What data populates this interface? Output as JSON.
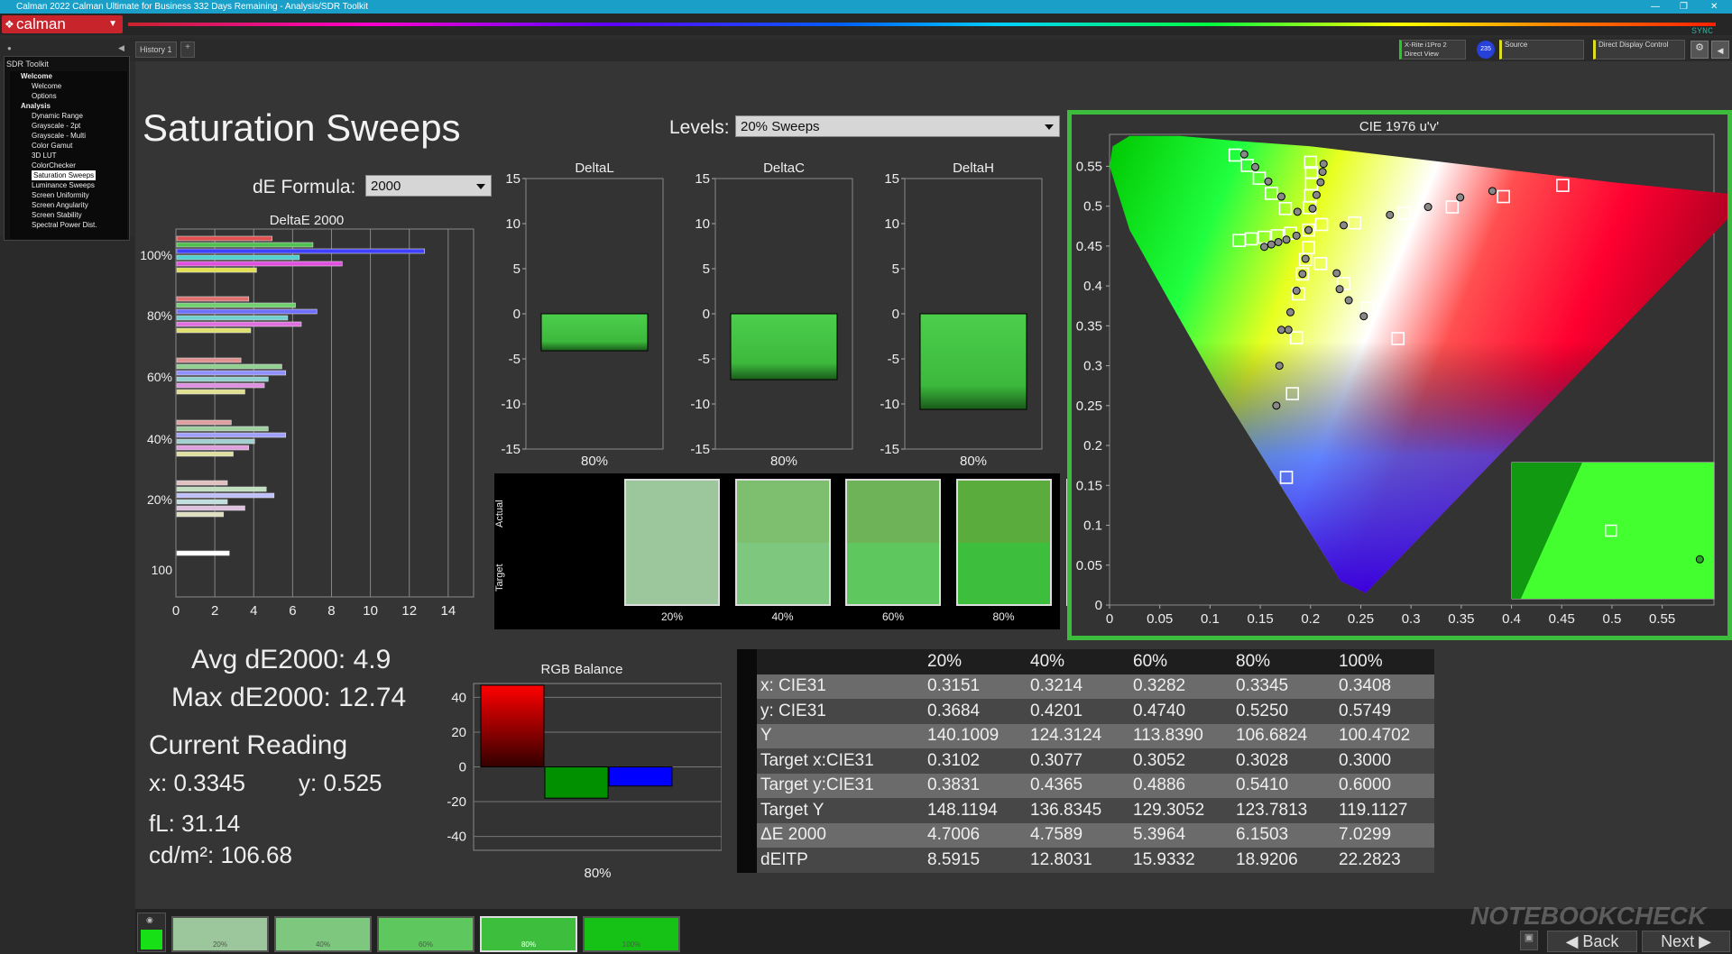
{
  "window": {
    "title": "Calman 2022 Calman Ultimate for Business 332 Days Remaining  - Analysis/SDR Toolkit",
    "sync": "SYNC"
  },
  "brand": {
    "logo": "calman"
  },
  "tabs": {
    "history": "History 1"
  },
  "toolbar": {
    "meter_line1": "X-Rite i1Pro 2",
    "meter_line2": "Direct View",
    "meter_badge": "235",
    "source": "Source",
    "display": "Direct Display Control"
  },
  "sidebar": {
    "title": "SDR Toolkit",
    "items": [
      {
        "label": "Welcome",
        "level": 1
      },
      {
        "label": "Welcome",
        "level": 2
      },
      {
        "label": "Options",
        "level": 2
      },
      {
        "label": "Analysis",
        "level": 1
      },
      {
        "label": "Dynamic Range",
        "level": 2
      },
      {
        "label": "Grayscale - 2pt",
        "level": 2
      },
      {
        "label": "Grayscale - Multi",
        "level": 2
      },
      {
        "label": "Color Gamut",
        "level": 2
      },
      {
        "label": "3D LUT",
        "level": 2
      },
      {
        "label": "ColorChecker",
        "level": 2
      },
      {
        "label": "Saturation Sweeps",
        "level": 2,
        "selected": true
      },
      {
        "label": "Luminance Sweeps",
        "level": 2
      },
      {
        "label": "Screen Uniformity",
        "level": 2
      },
      {
        "label": "Screen Angularity",
        "level": 2
      },
      {
        "label": "Screen Stability",
        "level": 2
      },
      {
        "label": "Spectral Power Dist.",
        "level": 2
      }
    ]
  },
  "page": {
    "title": "Saturation Sweeps",
    "levels_label": "Levels:",
    "levels_value": "20% Sweeps",
    "de_label": "dE Formula:",
    "de_value": "2000"
  },
  "summary": {
    "avg": "Avg dE2000: 4.9",
    "max": "Max dE2000: 12.74",
    "current_reading": "Current Reading",
    "x": "x: 0.3345",
    "y": "y: 0.525",
    "fl": "fL: 31.14",
    "cdm": "cd/m²: 106.68"
  },
  "chart_data": [
    {
      "type": "bar",
      "orientation": "horizontal",
      "title": "DeltaE 2000",
      "categories": [
        "100%",
        "80%",
        "60%",
        "40%",
        "20%",
        "100"
      ],
      "xticks": [
        "0",
        "2",
        "4",
        "6",
        "8",
        "10",
        "12",
        "14"
      ],
      "xlim": [
        0,
        15
      ],
      "groups": [
        {
          "level": "100%",
          "values": [
            4.9,
            7.0,
            12.74,
            6.3,
            8.5,
            4.1
          ],
          "colors": [
            "#e05050",
            "#50c050",
            "#4040ff",
            "#50d0d0",
            "#e050e0",
            "#e0e050"
          ]
        },
        {
          "level": "80%",
          "values": [
            3.7,
            6.1,
            7.2,
            5.7,
            6.4,
            3.8
          ],
          "colors": [
            "#e07070",
            "#70d070",
            "#7070ff",
            "#70d0d0",
            "#e070e0",
            "#e0e070"
          ]
        },
        {
          "level": "60%",
          "values": [
            3.3,
            5.4,
            5.6,
            4.7,
            4.5,
            3.5
          ],
          "colors": [
            "#e09090",
            "#90d090",
            "#9090ff",
            "#90d0d0",
            "#e090e0",
            "#e0e090"
          ]
        },
        {
          "level": "40%",
          "values": [
            2.8,
            4.7,
            5.6,
            4.0,
            3.7,
            2.9
          ],
          "colors": [
            "#e0a0a0",
            "#a0d0a0",
            "#a0a0ff",
            "#a0d0d0",
            "#e0a0e0",
            "#e0e0a0"
          ]
        },
        {
          "level": "20%",
          "values": [
            2.6,
            4.6,
            5.0,
            2.6,
            3.5,
            2.4
          ],
          "colors": [
            "#e0c0c0",
            "#c0e0c0",
            "#c0c0ff",
            "#c0e0e0",
            "#e0c0e0",
            "#e0e0c0"
          ]
        },
        {
          "level": "100",
          "values": [
            2.7
          ],
          "colors": [
            "#ffffff"
          ]
        }
      ]
    },
    {
      "type": "bar",
      "title": "DeltaL",
      "categories": [
        "80%"
      ],
      "values": [
        -4.1
      ],
      "ylim": [
        -15,
        15
      ],
      "yticks": [
        "15",
        "10",
        "5",
        "0",
        "-5",
        "-10",
        "-15"
      ]
    },
    {
      "type": "bar",
      "title": "DeltaC",
      "categories": [
        "80%"
      ],
      "values": [
        -7.3
      ],
      "ylim": [
        -15,
        15
      ],
      "yticks": [
        "15",
        "10",
        "5",
        "0",
        "-5",
        "-10",
        "-15"
      ]
    },
    {
      "type": "bar",
      "title": "DeltaH",
      "categories": [
        "80%"
      ],
      "values": [
        -10.6
      ],
      "ylim": [
        -15,
        15
      ],
      "yticks": [
        "15",
        "10",
        "5",
        "0",
        "-5",
        "-10",
        "-15"
      ]
    },
    {
      "type": "bar",
      "title": "RGB Balance",
      "categories": [
        "80%"
      ],
      "series": [
        {
          "name": "R",
          "value": 47,
          "color": "#ff0000"
        },
        {
          "name": "G",
          "value": -18,
          "color": "#009000"
        },
        {
          "name": "B",
          "value": -11,
          "color": "#0000ff"
        }
      ],
      "ylim": [
        -48,
        48
      ],
      "yticks": [
        "40",
        "20",
        "0",
        "-20",
        "-40"
      ]
    },
    {
      "type": "scatter",
      "title": "CIE 1976 u'v'",
      "xticks": [
        "0",
        "0.05",
        "0.1",
        "0.15",
        "0.2",
        "0.25",
        "0.3",
        "0.35",
        "0.4",
        "0.45",
        "0.5",
        "0.55"
      ],
      "yticks": [
        "0.55",
        "0.5",
        "0.45",
        "0.4",
        "0.35",
        "0.3",
        "0.25",
        "0.2",
        "0.15",
        "0.1",
        "0.05",
        "0"
      ],
      "xlim": [
        0,
        0.6
      ],
      "ylim": [
        0,
        0.59
      ],
      "targets": [
        [
          0.125,
          0.564
        ],
        [
          0.137,
          0.551
        ],
        [
          0.149,
          0.535
        ],
        [
          0.161,
          0.516
        ],
        [
          0.175,
          0.497
        ],
        [
          0.2,
          0.555
        ],
        [
          0.201,
          0.542
        ],
        [
          0.201,
          0.528
        ],
        [
          0.2,
          0.513
        ],
        [
          0.199,
          0.498
        ],
        [
          0.129,
          0.457
        ],
        [
          0.141,
          0.459
        ],
        [
          0.154,
          0.461
        ],
        [
          0.167,
          0.463
        ],
        [
          0.18,
          0.466
        ],
        [
          0.211,
          0.477
        ],
        [
          0.244,
          0.479
        ],
        [
          0.293,
          0.491
        ],
        [
          0.341,
          0.499
        ],
        [
          0.392,
          0.512
        ],
        [
          0.451,
          0.526
        ],
        [
          0.198,
          0.448
        ],
        [
          0.195,
          0.433
        ],
        [
          0.192,
          0.415
        ],
        [
          0.188,
          0.39
        ],
        [
          0.186,
          0.335
        ],
        [
          0.21,
          0.428
        ],
        [
          0.233,
          0.403
        ],
        [
          0.257,
          0.372
        ],
        [
          0.287,
          0.334
        ],
        [
          0.182,
          0.265
        ],
        [
          0.176,
          0.16
        ],
        [
          0.198,
          0.47
        ]
      ],
      "measured": [
        [
          0.134,
          0.565
        ],
        [
          0.145,
          0.549
        ],
        [
          0.158,
          0.531
        ],
        [
          0.171,
          0.512
        ],
        [
          0.187,
          0.493
        ],
        [
          0.213,
          0.553
        ],
        [
          0.212,
          0.543
        ],
        [
          0.21,
          0.53
        ],
        [
          0.206,
          0.514
        ],
        [
          0.202,
          0.497
        ],
        [
          0.154,
          0.449
        ],
        [
          0.161,
          0.452
        ],
        [
          0.168,
          0.455
        ],
        [
          0.176,
          0.458
        ],
        [
          0.186,
          0.463
        ],
        [
          0.233,
          0.476
        ],
        [
          0.279,
          0.489
        ],
        [
          0.317,
          0.499
        ],
        [
          0.349,
          0.511
        ],
        [
          0.381,
          0.519
        ],
        [
          0.195,
          0.434
        ],
        [
          0.192,
          0.415
        ],
        [
          0.186,
          0.394
        ],
        [
          0.18,
          0.367
        ],
        [
          0.178,
          0.345
        ],
        [
          0.226,
          0.416
        ],
        [
          0.229,
          0.396
        ],
        [
          0.238,
          0.382
        ],
        [
          0.253,
          0.362
        ],
        [
          0.171,
          0.345
        ],
        [
          0.169,
          0.3
        ],
        [
          0.166,
          0.25
        ],
        [
          0.198,
          0.47
        ]
      ],
      "inset_target": [
        0.49,
        0.5
      ],
      "inset_measured": [
        0.93,
        0.28
      ]
    }
  ],
  "panels": {
    "dl_x": "80%",
    "dc_x": "80%",
    "dh_x": "80%",
    "rgb_x": "80%",
    "de_title": "DeltaE 2000"
  },
  "swatches": {
    "actual_label": "Actual",
    "target_label": "Target",
    "items": [
      {
        "label": "20%",
        "actual": "#9cc79c",
        "target": "#9cc79c"
      },
      {
        "label": "40%",
        "actual": "#7dbf6f",
        "target": "#7ec77e"
      },
      {
        "label": "60%",
        "actual": "#6eb357",
        "target": "#5ec75e"
      },
      {
        "label": "80%",
        "actual": "#5aad3d",
        "target": "#3dbf3d"
      },
      {
        "label": "100%",
        "actual": "#5aa600",
        "target": "#17c217"
      }
    ]
  },
  "table": {
    "headers": [
      "",
      "20%",
      "40%",
      "60%",
      "80%",
      "100%"
    ],
    "rows": [
      [
        "x: CIE31",
        "0.3151",
        "0.3214",
        "0.3282",
        "0.3345",
        "0.3408"
      ],
      [
        "y: CIE31",
        "0.3684",
        "0.4201",
        "0.4740",
        "0.5250",
        "0.5749"
      ],
      [
        "Y",
        "140.1009",
        "124.3124",
        "113.8390",
        "106.6824",
        "100.4702"
      ],
      [
        "Target x:CIE31",
        "0.3102",
        "0.3077",
        "0.3052",
        "0.3028",
        "0.3000"
      ],
      [
        "Target y:CIE31",
        "0.3831",
        "0.4365",
        "0.4886",
        "0.5410",
        "0.6000"
      ],
      [
        "Target Y",
        "148.1194",
        "136.8345",
        "129.3052",
        "123.7813",
        "119.1127"
      ],
      [
        "ΔE 2000",
        "4.7006",
        "4.7589",
        "5.3964",
        "6.1503",
        "7.0299"
      ],
      [
        "dEITP",
        "8.5915",
        "12.8031",
        "15.9332",
        "18.9206",
        "22.2823"
      ]
    ]
  },
  "bottom": {
    "chips": [
      {
        "label": "20%",
        "color": "#9cc79c"
      },
      {
        "label": "40%",
        "color": "#7ec77e"
      },
      {
        "label": "60%",
        "color": "#5ec75e"
      },
      {
        "label": "80%",
        "color": "#3dbf3d"
      },
      {
        "label": "100%",
        "color": "#17c217"
      }
    ],
    "back": "Back",
    "next": "Next",
    "watermark": "NOTEBOOKCHECK"
  },
  "colors": {
    "accent": "#3dbb3d",
    "brand": "#c8242c",
    "titlebar": "#1aa0c8"
  }
}
